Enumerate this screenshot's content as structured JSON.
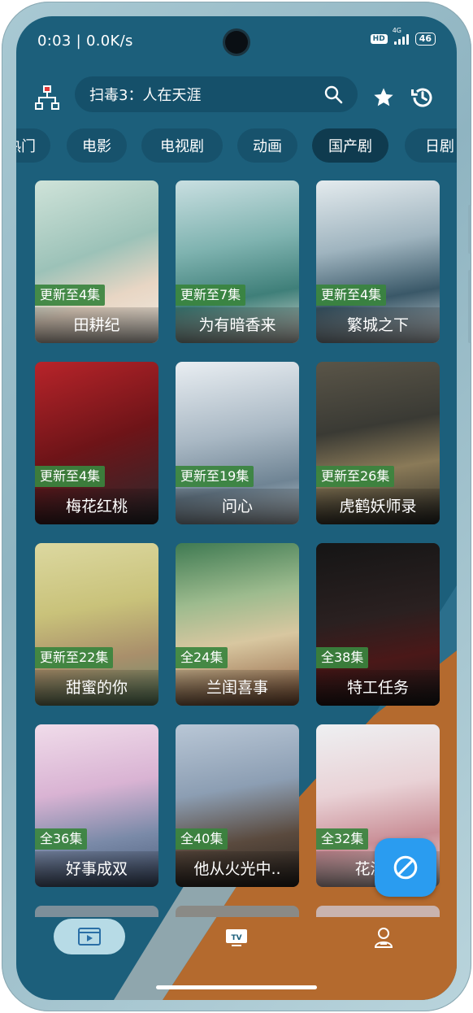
{
  "status_bar": {
    "time": "0:03 | 0.0K/s",
    "hd": "HD",
    "network": "4G",
    "battery": "46"
  },
  "search": {
    "text": "扫毒3：人在天涯"
  },
  "tabs": [
    "热门",
    "电影",
    "电视剧",
    "动画",
    "国产剧",
    "日剧"
  ],
  "active_tab": "国产剧",
  "cards": [
    {
      "title": "田耕纪",
      "badge": "更新至4集"
    },
    {
      "title": "为有暗香来",
      "badge": "更新至7集"
    },
    {
      "title": "繁城之下",
      "badge": "更新至4集"
    },
    {
      "title": "梅花红桃",
      "badge": "更新至4集"
    },
    {
      "title": "问心",
      "badge": "更新至19集"
    },
    {
      "title": "虎鹤妖师录",
      "badge": "更新至26集"
    },
    {
      "title": "甜蜜的你",
      "badge": "更新至22集"
    },
    {
      "title": "兰闺喜事",
      "badge": "全24集"
    },
    {
      "title": "特工任务",
      "badge": "全38集"
    },
    {
      "title": "好事成双",
      "badge": "全36集"
    },
    {
      "title": "他从火光中..",
      "badge": "全40集"
    },
    {
      "title": "花溪记",
      "badge": "全32集"
    }
  ],
  "nav": {
    "tv_label": "TV"
  },
  "colors": {
    "background": "#1c5f7b",
    "badge": "#3a843e",
    "fab": "#2a9cf0",
    "accent_wave": "#b46a2e"
  }
}
